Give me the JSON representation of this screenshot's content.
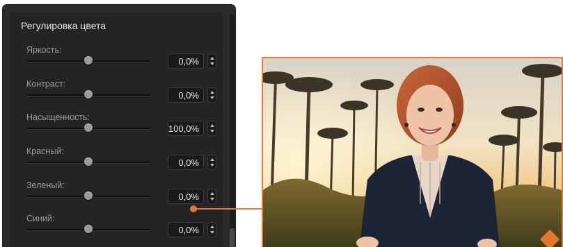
{
  "panel": {
    "title": "Регулировка цвета",
    "controls": [
      {
        "label": "Яркость:",
        "value": "0,0%",
        "level": 0.5
      },
      {
        "label": "Контраст:",
        "value": "0,0%",
        "level": 0.5
      },
      {
        "label": "Насыщенность:",
        "value": "100,0%",
        "level": 0.5
      },
      {
        "label": "Красный:",
        "value": "0,0%",
        "level": 0.5
      },
      {
        "label": "Зеленый:",
        "value": "0,0%",
        "level": 0.5
      },
      {
        "label": "Синий:",
        "value": "0,0%",
        "level": 0.5
      }
    ]
  },
  "preview": {
    "description_icon": "preview-image",
    "accent_color": "#e07a3f"
  }
}
